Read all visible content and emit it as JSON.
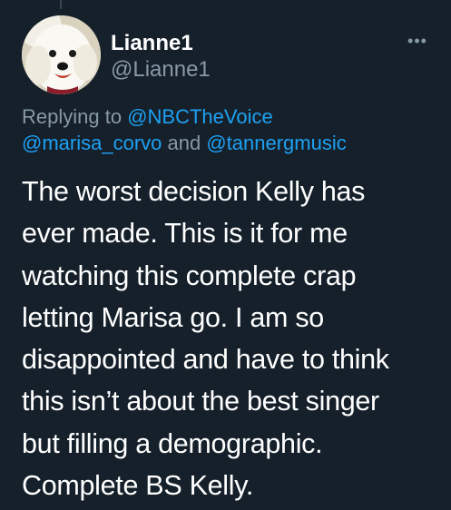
{
  "tweet": {
    "author": {
      "display_name": "Lianne1",
      "handle": "@Lianne1"
    },
    "more_icon": "more-horizontal-icon",
    "replying_to": {
      "prefix": "Replying to ",
      "mention_1": "@NBCTheVoice",
      "mention_2": "@marisa_corvo",
      "conjunction": " and ",
      "mention_3": "@tannergmusic"
    },
    "text_lines": [
      "The worst decision Kelly has",
      "ever made. This is it for me",
      "watching this complete crap",
      "letting Marisa go. I am so",
      "disappointed and have to think",
      "this isn’t about the best singer",
      "but filling a demographic.",
      "Complete BS Kelly."
    ]
  },
  "colors": {
    "background": "#15202b",
    "text_primary": "#ffffff",
    "text_secondary": "#8899a6",
    "link": "#1da1f2"
  }
}
